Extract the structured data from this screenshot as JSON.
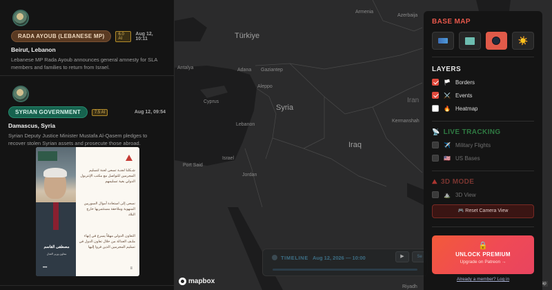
{
  "feed": {
    "items": [
      {
        "source": "RADA AYOUB (LEBANESE MP)",
        "ai": "6.0 AI",
        "time": "Aug 12, 10:11",
        "location": "Beirut, Lebanon",
        "summary": "Lebanese MP Rada Ayoub announces general amnesty for SLA members and families to return from Israel."
      },
      {
        "source": "SYRIAN GOVERNMENT",
        "ai": "7.5 AI",
        "time": "Aug 12, 09:54",
        "location": "Damascus, Syria",
        "summary": "Syrian Deputy Justice Minister Mustafa Al-Qasem pledges to recover stolen Syrian assets and prosecute those abroad.",
        "post": {
          "paragraph1": "شـكلنا لجنـة تسعى لجنة لتسليم المجرمين للتواصل مع مكتب الإنتربول الدولي بغية تسليمهم",
          "paragraph2": "نسعى إلى استعادة أموال السوريين المنهوبة وملاحقة مستثمريها خارج البلاد",
          "paragraph3": "التعاون الدولي مهمّاً يسرع في إنهاء ملـف العدالة من خلال تعاون الدول في تسليم المجرمين الذين فروا إليها",
          "name": "مصطفى القاسم",
          "role": "معاون وزير العدل",
          "dots": "•••",
          "icon": "≡"
        }
      }
    ]
  },
  "map": {
    "labels": {
      "turkey": "Türkiye",
      "syria": "Syria",
      "iraq": "Iraq",
      "lebanon": "Lebanon",
      "israel": "Israel",
      "jordan": "Jordan",
      "cyprus": "Cyprus",
      "antalya": "Antalya",
      "adana": "Adana",
      "gaziantep": "Gaziantep",
      "aleppo": "Aleppo",
      "kermanshah": "Kermanshah",
      "portsaid": "Port Said",
      "azerbaijan": "Azerbaija",
      "armenia": "Armenia",
      "riyadh": "Riyadh",
      "iran": "Iran"
    }
  },
  "timeline": {
    "label": "TIMELINE",
    "date": "Aug 12, 2026 — 10:00",
    "play": "▶",
    "extra": "Se"
  },
  "mapbox": {
    "logo": "mapbox",
    "attribution": "ap"
  },
  "panel": {
    "base_map_title": "BASE MAP",
    "layers_title": "LAYERS",
    "layers": [
      {
        "label": "Borders",
        "icon": "🏳️",
        "checked": true
      },
      {
        "label": "Events",
        "icon": "⚔️",
        "checked": true
      },
      {
        "label": "Heatmap",
        "icon": "🔥",
        "checked": false
      }
    ],
    "live_title": "LIVE TRACKING",
    "live": [
      {
        "label": "Military Flights",
        "icon": "✈️"
      },
      {
        "label": "US Bases",
        "icon": "🇺🇸"
      }
    ],
    "mode_title": "3D MODE",
    "mode_row": {
      "label": "3D View",
      "icon": "⛰️"
    },
    "reset_label": "🎮 Reset Camera View",
    "premium": {
      "lock": "🔒",
      "title": "UNLOCK PREMIUM",
      "subtitle": "Upgrade on Patreon →"
    },
    "member_link": "Already a member? Log in",
    "sun": "☀️"
  }
}
